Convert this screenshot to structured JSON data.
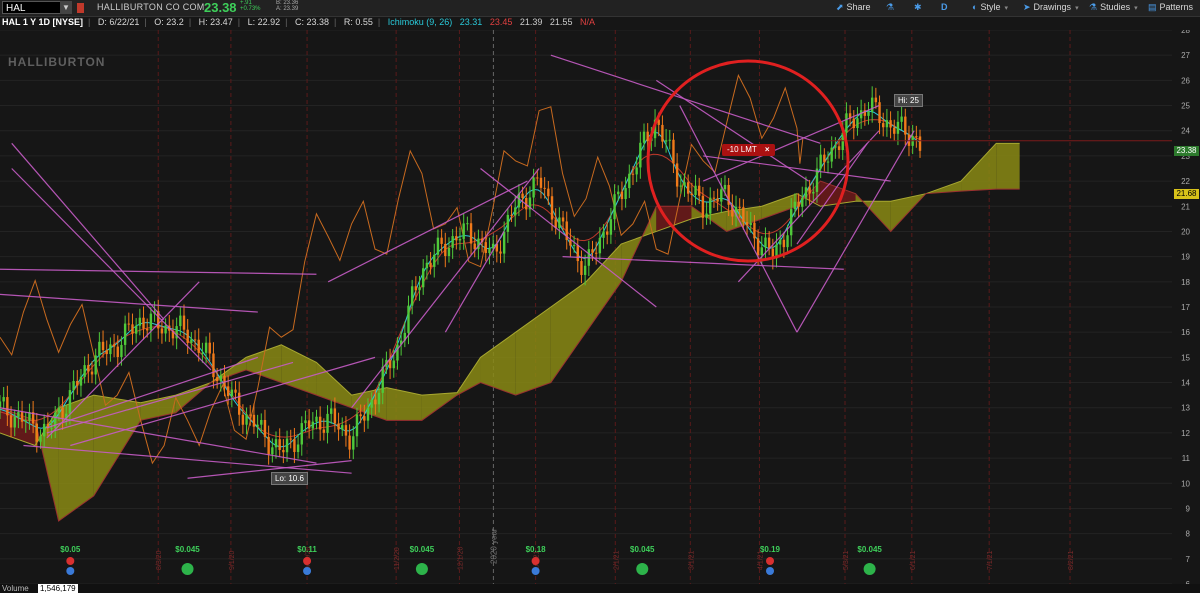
{
  "header": {
    "symbol": "HAL",
    "company": "HALLIBURTON CO COM",
    "last": "23.38",
    "change": "+.91",
    "change_pct": "+0.73%",
    "bid": "B: 23.36",
    "ask": "A: 23.39"
  },
  "toolbar": {
    "share": "Share",
    "period": "D",
    "style": "Style",
    "drawings": "Drawings",
    "studies": "Studies",
    "patterns": "Patterns"
  },
  "info": {
    "title": "HAL 1 Y 1D [NYSE]",
    "date": "D: 6/22/21",
    "open": "O: 23.2",
    "high": "H: 23.47",
    "low": "L: 22.92",
    "close": "C: 23.38",
    "range": "R: 0.55",
    "study": "Ichimoku (9, 26)",
    "v1": "23.31",
    "v2": "23.45",
    "v3": "21.39",
    "v4": "21.55",
    "v5": "N/A"
  },
  "colors": {
    "up": "#4fc93a",
    "down": "#f07a1a",
    "tenkan": "#29c8d8",
    "kijun": "#c0392b",
    "chikou": "#c86a1f",
    "trendline": "#c65cc6",
    "cloud_bull": "#8a8a14",
    "cloud_bear": "#6e1a1a",
    "annot_circle": "#e02020"
  },
  "labels": {
    "logo": "HALLIBURTON",
    "hi": "Hi: 25",
    "lo": "Lo: 10.6",
    "order": "-10 LMT",
    "order_close": "×",
    "year": "2020 year",
    "price_last": "23.38",
    "price_cloud": "21.68"
  },
  "volume": {
    "label": "Volume",
    "value": "1,546,179"
  },
  "chart_data": {
    "type": "candlestick",
    "ylim": [
      6,
      28
    ],
    "yticks": [
      6,
      7,
      8,
      9,
      10,
      11,
      12,
      13,
      14,
      15,
      16,
      17,
      18,
      19,
      20,
      21,
      22,
      23,
      24,
      25,
      26,
      27,
      28
    ],
    "xtick_labels": [
      "8/3/20",
      "9/1/20",
      "9/29/20",
      "11/2/20",
      "12/1/20",
      "1/4/21",
      "2/1/21",
      "3/1/21",
      "4/1/21",
      "5/3/21",
      "6/1/21",
      "7/1/21",
      "8/2/21"
    ],
    "xtick_frac": [
      0.135,
      0.197,
      0.262,
      0.338,
      0.392,
      0.457,
      0.525,
      0.589,
      0.648,
      0.721,
      0.778,
      0.844,
      0.913
    ],
    "close_series": [
      {
        "f": 0.0,
        "v": 13.0
      },
      {
        "f": 0.02,
        "v": 12.5
      },
      {
        "f": 0.04,
        "v": 12.0
      },
      {
        "f": 0.06,
        "v": 13.5
      },
      {
        "f": 0.08,
        "v": 15.0
      },
      {
        "f": 0.1,
        "v": 15.5
      },
      {
        "f": 0.12,
        "v": 16.5
      },
      {
        "f": 0.14,
        "v": 16.2
      },
      {
        "f": 0.16,
        "v": 16.0
      },
      {
        "f": 0.18,
        "v": 14.8
      },
      {
        "f": 0.2,
        "v": 13.2
      },
      {
        "f": 0.22,
        "v": 12.2
      },
      {
        "f": 0.24,
        "v": 11.2
      },
      {
        "f": 0.26,
        "v": 12.2
      },
      {
        "f": 0.28,
        "v": 12.6
      },
      {
        "f": 0.3,
        "v": 11.8
      },
      {
        "f": 0.32,
        "v": 13.5
      },
      {
        "f": 0.34,
        "v": 15.5
      },
      {
        "f": 0.36,
        "v": 18.5
      },
      {
        "f": 0.38,
        "v": 19.5
      },
      {
        "f": 0.4,
        "v": 20.0
      },
      {
        "f": 0.42,
        "v": 19.0
      },
      {
        "f": 0.44,
        "v": 21.0
      },
      {
        "f": 0.46,
        "v": 22.0
      },
      {
        "f": 0.48,
        "v": 20.0
      },
      {
        "f": 0.5,
        "v": 18.5
      },
      {
        "f": 0.52,
        "v": 20.5
      },
      {
        "f": 0.54,
        "v": 22.5
      },
      {
        "f": 0.56,
        "v": 24.5
      },
      {
        "f": 0.58,
        "v": 22.0
      },
      {
        "f": 0.6,
        "v": 21.0
      },
      {
        "f": 0.62,
        "v": 21.5
      },
      {
        "f": 0.64,
        "v": 20.0
      },
      {
        "f": 0.66,
        "v": 19.0
      },
      {
        "f": 0.68,
        "v": 21.0
      },
      {
        "f": 0.7,
        "v": 22.5
      },
      {
        "f": 0.72,
        "v": 24.0
      },
      {
        "f": 0.74,
        "v": 25.0
      },
      {
        "f": 0.76,
        "v": 24.2
      },
      {
        "f": 0.78,
        "v": 23.8
      },
      {
        "f": 0.785,
        "v": 23.38
      }
    ],
    "ichimoku": {
      "study": "Ichimoku (9, 26)",
      "span_a": [
        {
          "f": 0.0,
          "v": 12.0
        },
        {
          "f": 0.03,
          "v": 11.5
        },
        {
          "f": 0.05,
          "v": 13.0
        },
        {
          "f": 0.08,
          "v": 13.5
        },
        {
          "f": 0.12,
          "v": 13.2
        },
        {
          "f": 0.15,
          "v": 13.5
        },
        {
          "f": 0.18,
          "v": 14.0
        },
        {
          "f": 0.21,
          "v": 15.0
        },
        {
          "f": 0.24,
          "v": 15.5
        },
        {
          "f": 0.27,
          "v": 14.8
        },
        {
          "f": 0.3,
          "v": 13.5
        },
        {
          "f": 0.33,
          "v": 13.8
        },
        {
          "f": 0.36,
          "v": 13.5
        },
        {
          "f": 0.39,
          "v": 13.6
        },
        {
          "f": 0.41,
          "v": 15.0
        },
        {
          "f": 0.44,
          "v": 16.0
        },
        {
          "f": 0.47,
          "v": 17.0
        },
        {
          "f": 0.5,
          "v": 18.0
        },
        {
          "f": 0.53,
          "v": 19.5
        },
        {
          "f": 0.56,
          "v": 20.0
        },
        {
          "f": 0.59,
          "v": 20.5
        },
        {
          "f": 0.62,
          "v": 20.8
        },
        {
          "f": 0.65,
          "v": 21.0
        },
        {
          "f": 0.68,
          "v": 21.5
        },
        {
          "f": 0.7,
          "v": 21.0
        },
        {
          "f": 0.73,
          "v": 21.2
        },
        {
          "f": 0.76,
          "v": 21.2
        },
        {
          "f": 0.79,
          "v": 21.5
        },
        {
          "f": 0.82,
          "v": 22.0
        },
        {
          "f": 0.85,
          "v": 23.5
        },
        {
          "f": 0.87,
          "v": 23.5
        }
      ],
      "span_b": [
        {
          "f": 0.0,
          "v": 13.0
        },
        {
          "f": 0.03,
          "v": 12.5
        },
        {
          "f": 0.05,
          "v": 8.5
        },
        {
          "f": 0.08,
          "v": 9.5
        },
        {
          "f": 0.12,
          "v": 12.5
        },
        {
          "f": 0.15,
          "v": 12.8
        },
        {
          "f": 0.18,
          "v": 14.0
        },
        {
          "f": 0.21,
          "v": 14.5
        },
        {
          "f": 0.24,
          "v": 14.0
        },
        {
          "f": 0.27,
          "v": 13.5
        },
        {
          "f": 0.3,
          "v": 13.0
        },
        {
          "f": 0.33,
          "v": 12.5
        },
        {
          "f": 0.36,
          "v": 12.5
        },
        {
          "f": 0.39,
          "v": 13.5
        },
        {
          "f": 0.41,
          "v": 14.0
        },
        {
          "f": 0.44,
          "v": 13.5
        },
        {
          "f": 0.47,
          "v": 14.0
        },
        {
          "f": 0.5,
          "v": 16.0
        },
        {
          "f": 0.53,
          "v": 18.0
        },
        {
          "f": 0.56,
          "v": 21.0
        },
        {
          "f": 0.59,
          "v": 21.0
        },
        {
          "f": 0.62,
          "v": 20.0
        },
        {
          "f": 0.65,
          "v": 20.5
        },
        {
          "f": 0.68,
          "v": 21.0
        },
        {
          "f": 0.7,
          "v": 22.0
        },
        {
          "f": 0.73,
          "v": 21.5
        },
        {
          "f": 0.76,
          "v": 20.0
        },
        {
          "f": 0.79,
          "v": 21.5
        },
        {
          "f": 0.82,
          "v": 21.6
        },
        {
          "f": 0.85,
          "v": 21.68
        },
        {
          "f": 0.87,
          "v": 21.68
        }
      ]
    },
    "trendlines": [
      [
        0.01,
        23.5,
        0.14,
        16.5
      ],
      [
        0.01,
        22.5,
        0.18,
        14.5
      ],
      [
        0.0,
        18.5,
        0.27,
        18.3
      ],
      [
        0.0,
        17.5,
        0.22,
        16.8
      ],
      [
        0.0,
        13.0,
        0.27,
        10.8
      ],
      [
        0.02,
        11.5,
        0.3,
        10.4
      ],
      [
        0.04,
        11.8,
        0.17,
        18.0
      ],
      [
        0.04,
        12.2,
        0.22,
        15.0
      ],
      [
        0.04,
        12.0,
        0.25,
        14.8
      ],
      [
        0.06,
        11.5,
        0.32,
        15.0
      ],
      [
        0.16,
        10.2,
        0.3,
        10.9
      ],
      [
        0.28,
        18.0,
        0.45,
        22.0
      ],
      [
        0.3,
        13.0,
        0.46,
        22.5
      ],
      [
        0.38,
        16.0,
        0.43,
        20.0
      ],
      [
        0.41,
        22.5,
        0.56,
        17.0
      ],
      [
        0.48,
        19.0,
        0.72,
        18.5
      ],
      [
        0.47,
        27.0,
        0.7,
        23.5
      ],
      [
        0.56,
        26.0,
        0.69,
        22.0
      ],
      [
        0.58,
        25.0,
        0.68,
        16.0
      ],
      [
        0.6,
        22.0,
        0.75,
        25.0
      ],
      [
        0.6,
        23.0,
        0.76,
        22.0
      ],
      [
        0.63,
        18.0,
        0.75,
        24.0
      ],
      [
        0.68,
        16.0,
        0.78,
        24.0
      ],
      [
        0.68,
        19.5,
        0.74,
        23.5
      ]
    ],
    "dividends": [
      {
        "f": 0.06,
        "label": "$0.05"
      },
      {
        "f": 0.16,
        "label": "$0.045"
      },
      {
        "f": 0.262,
        "label": "$0.11"
      },
      {
        "f": 0.36,
        "label": "$0.045"
      },
      {
        "f": 0.457,
        "label": "$0.18"
      },
      {
        "f": 0.548,
        "label": "$0.045"
      },
      {
        "f": 0.657,
        "label": "$0.19"
      },
      {
        "f": 0.742,
        "label": "$0.045"
      }
    ]
  }
}
